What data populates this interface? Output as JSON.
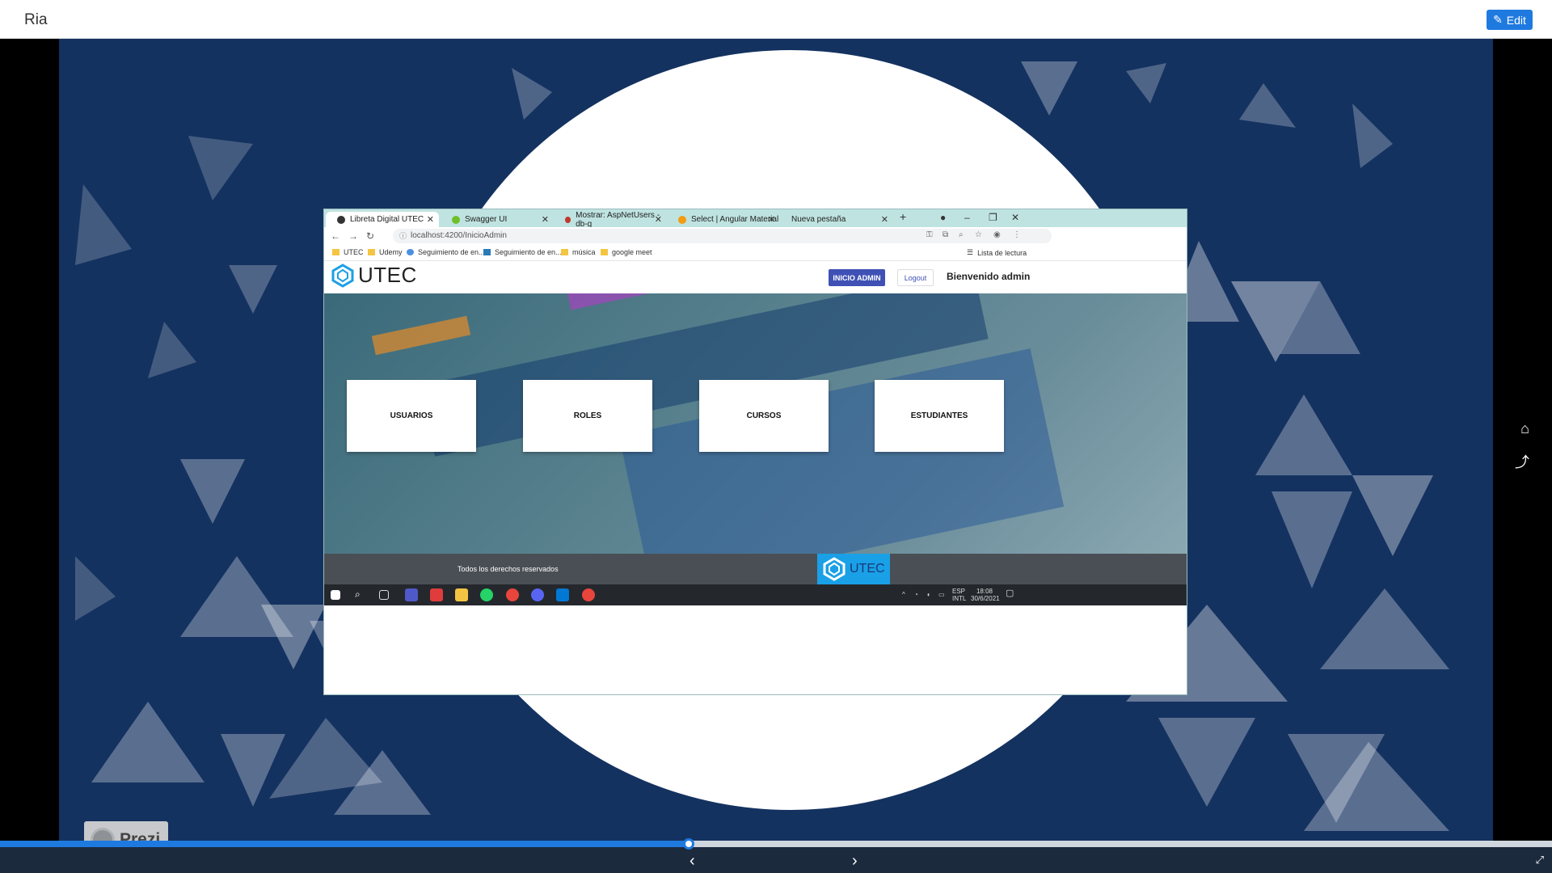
{
  "app": {
    "title": "Ria",
    "edit_label": "Edit",
    "edit_icon": "pencil-icon"
  },
  "browser": {
    "tabs": [
      {
        "label": "Libreta Digital UTEC",
        "active": true,
        "favicon_color": "#333333"
      },
      {
        "label": "Swagger UI",
        "active": false,
        "favicon_color": "#6fbf2a"
      },
      {
        "label": "Mostrar: AspNetUsers - db-g",
        "active": false,
        "favicon_color": "#c0392b"
      },
      {
        "label": "Select | Angular Material",
        "active": false,
        "favicon_color": "#f39c12"
      },
      {
        "label": "Nueva pestaña",
        "active": false,
        "favicon_color": ""
      }
    ],
    "url": "localhost:4200/InicioAdmin",
    "bookmarks": [
      "UTEC",
      "Udemy",
      "Seguimiento de en...",
      "Seguimiento de en...",
      "música",
      "google meet"
    ],
    "reading_list": "Lista de lectura"
  },
  "page": {
    "logo_text": "UTEC",
    "inicio_admin": "INICIO ADMIN",
    "logout": "Logout",
    "welcome": "Bienvenido admin",
    "cards": [
      "USUARIOS",
      "ROLES",
      "CURSOS",
      "ESTUDIANTES"
    ],
    "footer_text": "Todos los derechos reservados",
    "footer_logo": "UTEC"
  },
  "taskbar": {
    "lang1": "ESP",
    "lang2": "INTL",
    "time": "18:08",
    "date": "30/6/2021"
  },
  "prezi": {
    "badge_label": "Prezi"
  },
  "player": {
    "progress": 0.444
  },
  "colors": {
    "accent": "#1f7ae0",
    "background": "#143260",
    "admin_button": "#3f51b5"
  }
}
